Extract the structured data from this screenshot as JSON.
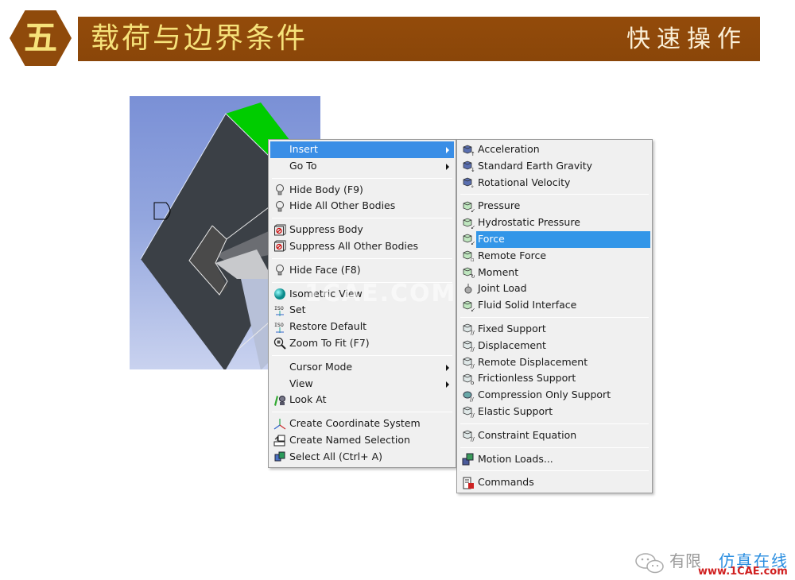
{
  "header": {
    "section_number": "五",
    "title": "载荷与边界条件",
    "subtitle": "快速操作"
  },
  "colors": {
    "banner": "#8f4a0b",
    "banner_text": "#f6e27a",
    "menu_highlight": "#3a8ee6",
    "selected_face": "#00cc00",
    "body": "#3b4046"
  },
  "viewport_watermark": "1CAE.COM",
  "context_menu": {
    "groups": [
      [
        {
          "label": "Insert",
          "icon": "none",
          "submenu": true,
          "highlighted": true
        },
        {
          "label": "Go To",
          "icon": "none",
          "submenu": true
        }
      ],
      [
        {
          "label": "Hide Body (F9)",
          "icon": "lightbulb-icon"
        },
        {
          "label": "Hide All Other Bodies",
          "icon": "lightbulb-icon"
        }
      ],
      [
        {
          "label": "Suppress Body",
          "icon": "suppress-icon"
        },
        {
          "label": "Suppress All Other Bodies",
          "icon": "suppress-icon"
        }
      ],
      [
        {
          "label": "Hide Face (F8)",
          "icon": "lightbulb-icon"
        }
      ],
      [
        {
          "label": "Isometric View",
          "icon": "sphere-icon"
        },
        {
          "label": "Set",
          "icon": "iso-set-icon"
        },
        {
          "label": "Restore Default",
          "icon": "iso-restore-icon"
        },
        {
          "label": "Zoom To Fit (F7)",
          "icon": "zoom-fit-icon"
        }
      ],
      [
        {
          "label": "Cursor Mode",
          "icon": "none",
          "submenu": true
        },
        {
          "label": "View",
          "icon": "none",
          "submenu": true
        },
        {
          "label": "Look At",
          "icon": "look-at-icon"
        }
      ],
      [
        {
          "label": "Create Coordinate System",
          "icon": "coordinate-system-icon"
        },
        {
          "label": "Create Named Selection",
          "icon": "named-selection-icon"
        },
        {
          "label": "Select All (Ctrl+ A)",
          "icon": "select-all-icon"
        }
      ]
    ]
  },
  "insert_submenu": {
    "groups": [
      [
        {
          "label": "Acceleration",
          "icon": "acceleration-icon"
        },
        {
          "label": "Standard Earth Gravity",
          "icon": "gravity-icon"
        },
        {
          "label": "Rotational Velocity",
          "icon": "rotational-velocity-icon"
        }
      ],
      [
        {
          "label": "Pressure",
          "icon": "pressure-icon"
        },
        {
          "label": "Hydrostatic Pressure",
          "icon": "hydrostatic-pressure-icon"
        },
        {
          "label": "Force",
          "icon": "force-icon",
          "highlighted": true
        },
        {
          "label": "Remote Force",
          "icon": "remote-force-icon"
        },
        {
          "label": "Moment",
          "icon": "moment-icon"
        },
        {
          "label": "Joint Load",
          "icon": "joint-load-icon"
        },
        {
          "label": "Fluid Solid Interface",
          "icon": "fluid-solid-interface-icon"
        }
      ],
      [
        {
          "label": "Fixed Support",
          "icon": "fixed-support-icon"
        },
        {
          "label": "Displacement",
          "icon": "displacement-icon"
        },
        {
          "label": "Remote Displacement",
          "icon": "remote-displacement-icon"
        },
        {
          "label": "Frictionless Support",
          "icon": "frictionless-support-icon"
        },
        {
          "label": "Compression Only Support",
          "icon": "compression-only-support-icon"
        },
        {
          "label": "Elastic Support",
          "icon": "elastic-support-icon"
        }
      ],
      [
        {
          "label": "Constraint Equation",
          "icon": "constraint-equation-icon"
        }
      ],
      [
        {
          "label": "Motion Loads...",
          "icon": "motion-loads-icon"
        }
      ],
      [
        {
          "label": "Commands",
          "icon": "commands-icon"
        }
      ]
    ]
  },
  "footer": {
    "brand_gray": "有限",
    "brand_blue": "仿真在线",
    "url": "www.1CAE.com"
  }
}
